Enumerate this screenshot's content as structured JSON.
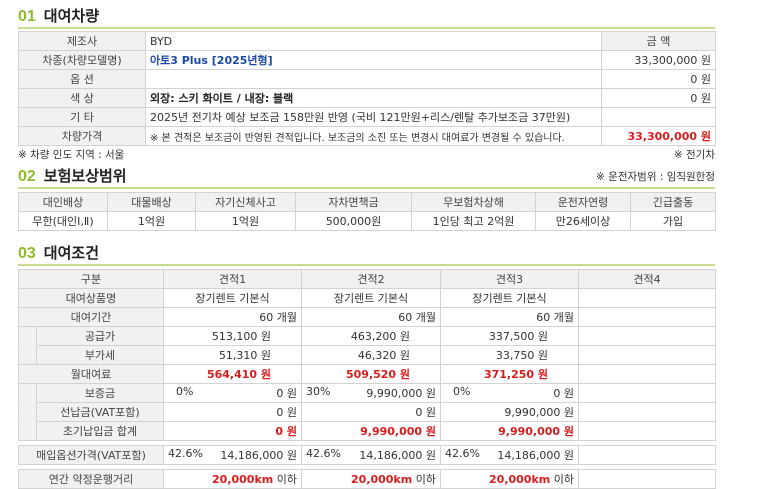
{
  "sec1": {
    "num": "01",
    "title": "대여차량",
    "amount_header": "금 액",
    "rows": [
      {
        "label": "제조사",
        "value": "BYD",
        "amount": ""
      },
      {
        "label": "차종(차량모델명)",
        "value": "아토3 Plus [2025년형]",
        "amount": "33,300,000 원"
      },
      {
        "label": "옵 션",
        "value": "",
        "amount": "0 원"
      },
      {
        "label": "색 상",
        "value": "외장: 스키 화이트 / 내장: 블랙",
        "amount": "0 원"
      },
      {
        "label": "기 타",
        "value": "2025년 전기차 예상 보조금 158만원 반영 (국비 121만원+리스/렌탈 추가보조금 37만원)",
        "amount": ""
      },
      {
        "label": "차량가격",
        "value": "※ 본 견적은 보조금이 반영된 견적입니다. 보조금의 소진 또는 변경시 대여료가 변경될 수 있습니다.",
        "amount": "33,300,000 원"
      }
    ],
    "note_left": "※ 차량 인도 지역 : 서울",
    "note_right": "※ 전기차"
  },
  "sec2": {
    "num": "02",
    "title": "보험보상범위",
    "note_right": "※ 운전자범위 : 임직원한정",
    "headers": [
      "대인배상",
      "대물배상",
      "자기신체사고",
      "자차면책금",
      "무보험차상해",
      "운전자연령",
      "긴급출동"
    ],
    "values": [
      "무한(대인Ⅰ,Ⅱ)",
      "1억원",
      "1억원",
      "500,000원",
      "1인당 최고 2억원",
      "만26세이상",
      "가입"
    ]
  },
  "sec3": {
    "num": "03",
    "title": "대여조건",
    "col_header": "구분",
    "quotes": [
      "견적1",
      "견적2",
      "견적3",
      "견적4"
    ],
    "product_label": "대여상품명",
    "product": [
      "장기렌트 기본식",
      "장기렌트 기본식",
      "장기렌트 기본식",
      ""
    ],
    "period_label": "대여기간",
    "period": [
      "60 개월",
      "60 개월",
      "60 개월",
      ""
    ],
    "supply_label": "공급가",
    "supply": [
      "513,100 원",
      "463,200 원",
      "337,500 원",
      ""
    ],
    "vat_label": "부가세",
    "vat": [
      "51,310 원",
      "46,320 원",
      "33,750 원",
      ""
    ],
    "monthly_label": "월대여료",
    "monthly": [
      "564,410 원",
      "509,520 원",
      "371,250 원",
      ""
    ],
    "deposit_label": "보증금",
    "deposit_pct": [
      "0%",
      "30%",
      "0%",
      ""
    ],
    "deposit": [
      "0 원",
      "9,990,000 원",
      "0 원",
      ""
    ],
    "prepay_label": "선납금(VAT포함)",
    "prepay": [
      "0 원",
      "0 원",
      "9,990,000 원",
      ""
    ],
    "initial_label": "초기납입금 합계",
    "initial": [
      "0 원",
      "9,990,000 원",
      "9,990,000 원",
      ""
    ],
    "buyout_label": "매입옵션가격(VAT포함)",
    "buyout_pct": [
      "42.6%",
      "42.6%",
      "42.6%",
      ""
    ],
    "buyout": [
      "14,186,000 원",
      "14,186,000 원",
      "14,186,000 원",
      ""
    ],
    "mileage_label": "연간 약정운행거리",
    "mileage": [
      "20,000km",
      "20,000km",
      "20,000km",
      ""
    ],
    "mileage_suffix": "이하"
  }
}
